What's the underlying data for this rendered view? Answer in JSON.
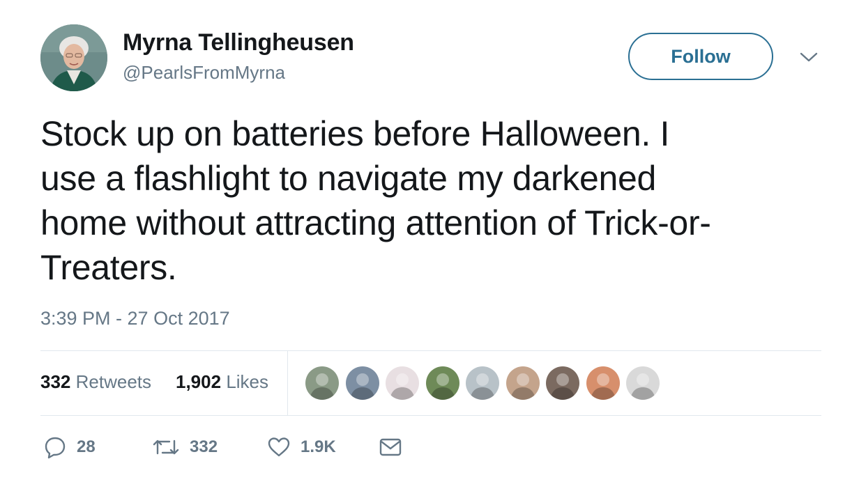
{
  "author": {
    "display_name": "Myrna Tellingheusen",
    "handle": "@PearlsFromMyrna"
  },
  "follow_button": {
    "label": "Follow"
  },
  "tweet": {
    "lines": [
      "Stock up on batteries before Halloween. I",
      "use a flashlight to navigate my darkened",
      "home without attracting attention of Trick-or-",
      "Treaters."
    ],
    "timestamp": "3:39 PM - 27 Oct 2017"
  },
  "stats": {
    "retweets_count": "332",
    "retweets_label": "Retweets",
    "likes_count": "1,902",
    "likes_label": "Likes"
  },
  "likers": [
    {
      "icon": "liker-avatar",
      "bg": "#8a9a86"
    },
    {
      "icon": "liker-avatar",
      "bg": "#7d8fa3"
    },
    {
      "icon": "liker-avatar",
      "bg": "#e8dfe2"
    },
    {
      "icon": "liker-avatar",
      "bg": "#6e8a58"
    },
    {
      "icon": "liker-avatar",
      "bg": "#b8c2c8"
    },
    {
      "icon": "liker-avatar",
      "bg": "#c4a48c"
    },
    {
      "icon": "liker-avatar",
      "bg": "#7b6a60"
    },
    {
      "icon": "liker-avatar",
      "bg": "#d78f6c"
    },
    {
      "icon": "liker-avatar",
      "bg": "#d9d9d9"
    }
  ],
  "actions": {
    "reply_count": "28",
    "retweet_count": "332",
    "like_count": "1.9K"
  },
  "colors": {
    "text": "#14171a",
    "secondary": "#657786",
    "follow_accent": "#2a6f93",
    "divider": "#e1e8ed"
  }
}
